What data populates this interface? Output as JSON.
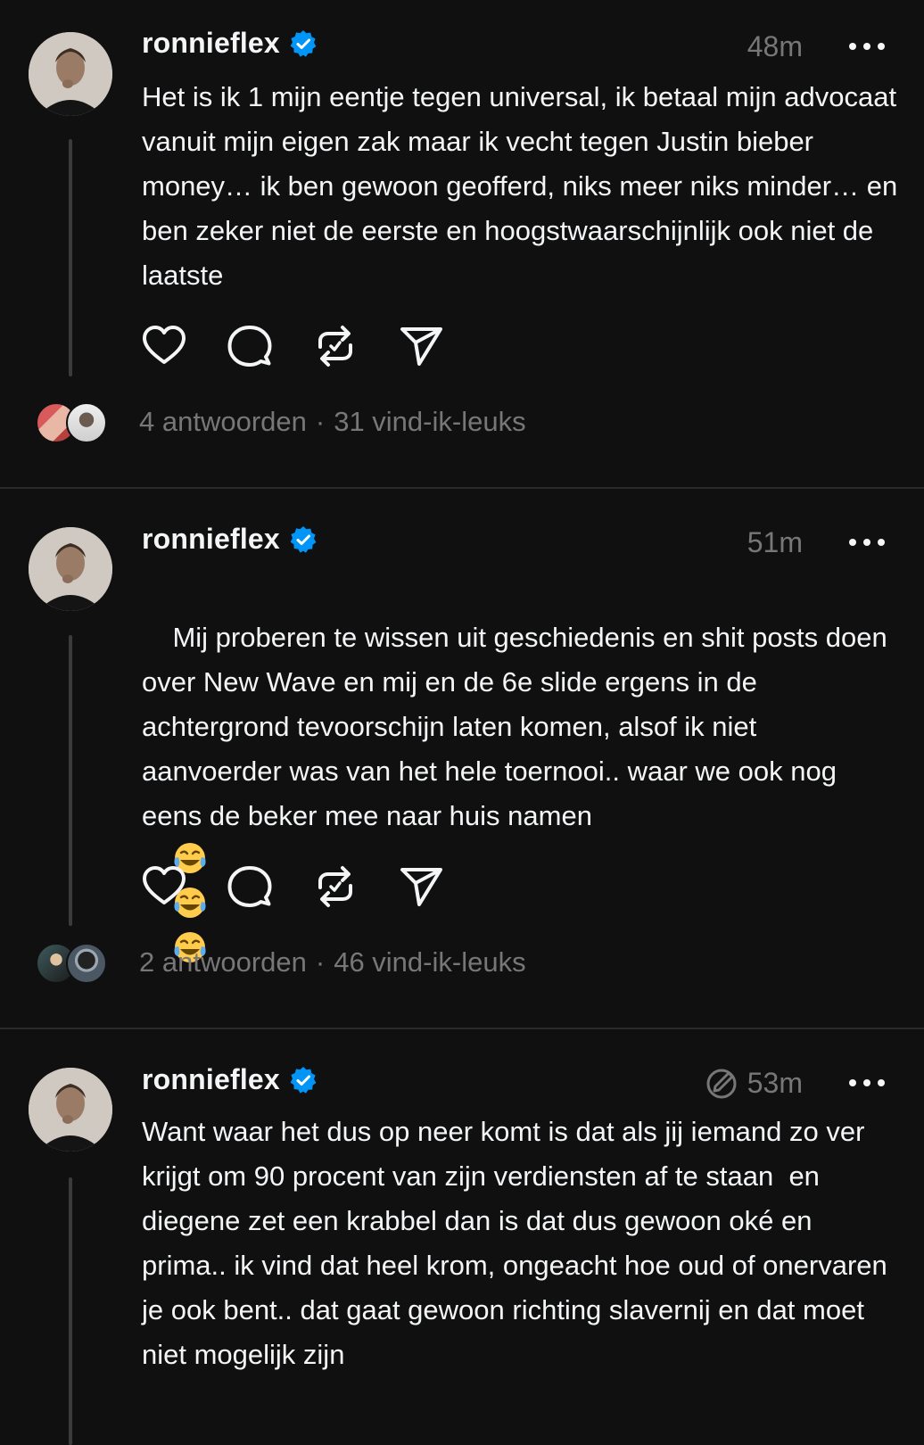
{
  "posts": [
    {
      "username": "ronnieflex",
      "verified": true,
      "time": "48m",
      "text": "Het is ik 1 mijn eentje tegen universal, ik betaal mijn advocaat vanuit mijn eigen zak maar ik vecht tegen Justin bieber money… ik ben gewoon geofferd, niks meer niks minder… en ben zeker niet de eerste en hoogstwaarschijnlijk ook niet de laatste",
      "replies": "4 antwoorden",
      "likes": "31 vind-ik-leuks",
      "separator": "·"
    },
    {
      "username": "ronnieflex",
      "verified": true,
      "time": "51m",
      "text": "Mij proberen te wissen uit geschiedenis en shit posts doen over New Wave en mij en de 6e slide ergens in de achtergrond tevoorschijn laten komen, alsof ik niet aanvoerder was van het hele toernooi.. waar we ook nog eens de beker mee naar huis namen",
      "emojis": [
        "tears-of-joy",
        "tears-of-joy",
        "tears-of-joy"
      ],
      "replies": "2 antwoorden",
      "likes": "46 vind-ik-leuks",
      "separator": "·"
    },
    {
      "username": "ronnieflex",
      "verified": true,
      "edited_icon": "edited-icon",
      "time": "53m",
      "text": "Want waar het dus op neer komt is dat als jij iemand zo ver krijgt om 90 procent van zijn verdiensten af te staan  en diegene zet een krabbel dan is dat dus gewoon oké en prima.. ik vind dat heel krom, ongeacht hoe oud of onervaren je ook bent.. dat gaat gewoon richting slavernij en dat moet niet mogelijk zijn"
    }
  ],
  "icons": {
    "like": "heart-icon",
    "reply": "comment-icon",
    "repost": "repost-icon",
    "share": "send-icon",
    "more": "more-icon",
    "verified": "verified-badge-icon"
  },
  "colors": {
    "background": "#101010",
    "text": "#f3f5f7",
    "muted": "#777777",
    "verified": "#0095f6",
    "divider": "#2a2a2a"
  }
}
